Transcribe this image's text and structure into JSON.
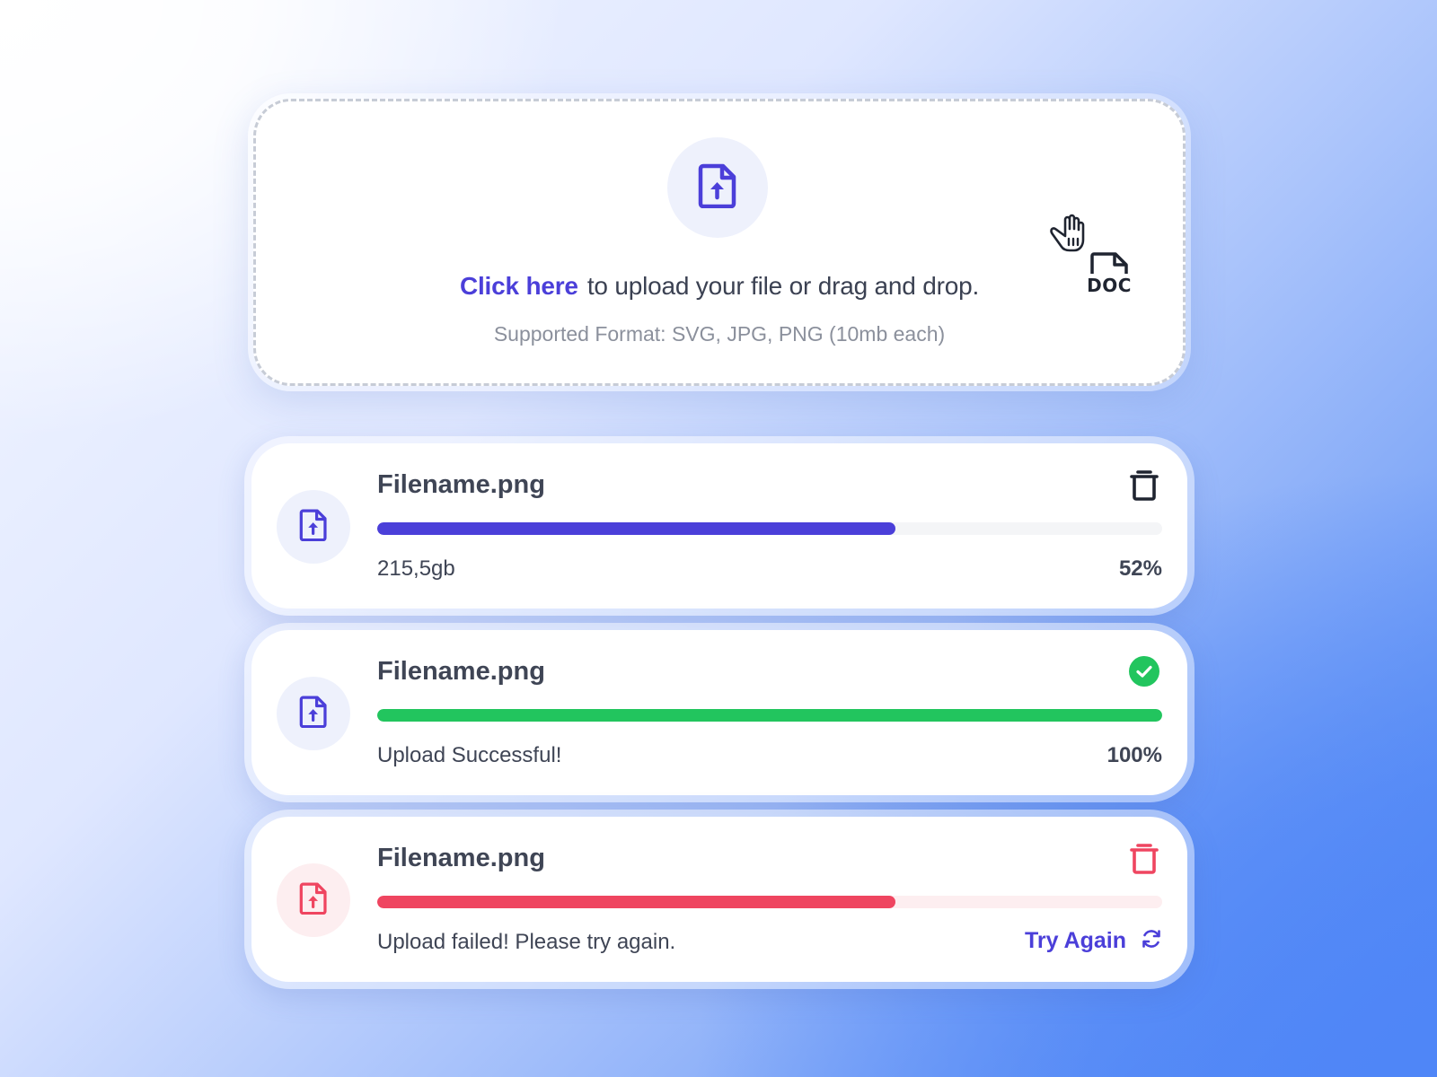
{
  "dropzone": {
    "link_text": "Click here",
    "title_text": "to upload your file or drag and drop.",
    "supported_text": "Supported Format: SVG, JPG, PNG (10mb each)",
    "icon": "file-upload-icon",
    "drag_icon": "hand-grab-icon",
    "drag_file_label": "DOC"
  },
  "files": [
    {
      "name": "Filename.png",
      "status": "uploading",
      "left_text": "215,5gb",
      "right_text": "52%",
      "progress": 0.66,
      "color": "#4b3fd9",
      "action_icon": "trash-icon"
    },
    {
      "name": "Filename.png",
      "status": "success",
      "left_text": "Upload Successful!",
      "right_text": "100%",
      "progress": 1.0,
      "color": "#22c55e",
      "action_icon": "check-circle-icon"
    },
    {
      "name": "Filename.png",
      "status": "error",
      "left_text": "Upload failed! Please try again.",
      "right_text": "Try Again",
      "progress": 0.66,
      "color": "#ef4560",
      "action_icon": "trash-icon",
      "retry_icon": "refresh-icon"
    }
  ],
  "colors": {
    "accent": "#4b3fd9",
    "success": "#22c55e",
    "error": "#ef4560",
    "text": "#3f4555"
  }
}
